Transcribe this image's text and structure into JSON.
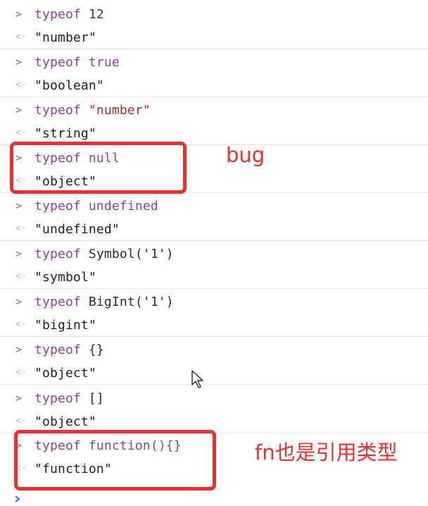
{
  "console": {
    "input_prompt": ">",
    "output_prompt": "<·",
    "entries": [
      {
        "input": {
          "keyword": "typeof",
          "arg": "12"
        },
        "output": "\"number\""
      },
      {
        "input": {
          "keyword": "typeof",
          "arg": "true"
        },
        "output": "\"boolean\""
      },
      {
        "input": {
          "keyword": "typeof",
          "arg": "\"number\""
        },
        "output": "\"string\""
      },
      {
        "input": {
          "keyword": "typeof",
          "arg": "null"
        },
        "output": "\"object\""
      },
      {
        "input": {
          "keyword": "typeof",
          "arg": "undefined"
        },
        "output": "\"undefined\""
      },
      {
        "input": {
          "keyword": "typeof",
          "arg": "Symbol('1')"
        },
        "output": "\"symbol\""
      },
      {
        "input": {
          "keyword": "typeof",
          "arg": "BigInt('1')"
        },
        "output": "\"bigint\""
      },
      {
        "input": {
          "keyword": "typeof",
          "arg": "{}"
        },
        "output": "\"object\""
      },
      {
        "input": {
          "keyword": "typeof",
          "arg": "[]"
        },
        "output": "\"object\""
      },
      {
        "input": {
          "keyword": "typeof",
          "arg": "function(){}"
        },
        "output": "\"function\""
      }
    ]
  },
  "annotations": {
    "bug_note": "bug",
    "fn_note": "fn也是引用类型",
    "highlight_color": "#ee2d2d"
  },
  "colors": {
    "keyword": "#8f3f99",
    "number": "#2436a8",
    "string": "#b32b24",
    "plain": "#2b2b2b",
    "output": "#1f1f1f"
  },
  "icons": {
    "input_prompt": "chevron-right-icon",
    "output_prompt": "return-arrow-icon",
    "cursor": "mouse-pointer-icon"
  }
}
